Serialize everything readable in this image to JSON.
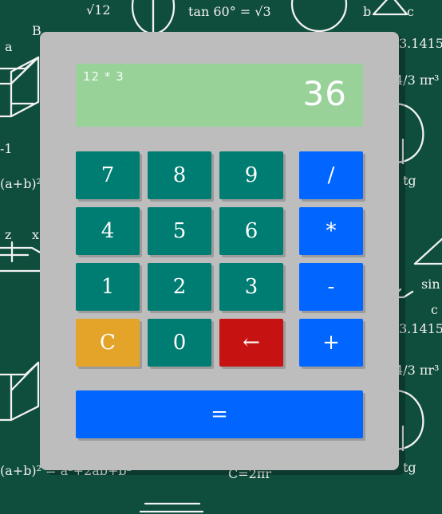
{
  "display": {
    "expression": "12 * 3",
    "result": "36"
  },
  "keys": {
    "seven": "7",
    "eight": "8",
    "nine": "9",
    "divide": "/",
    "four": "4",
    "five": "5",
    "six": "6",
    "multiply": "*",
    "one": "1",
    "two": "2",
    "three": "3",
    "subtract": "-",
    "clear": "C",
    "zero": "0",
    "backspace": "←",
    "add": "+",
    "equals": "="
  },
  "colors": {
    "background": "#0f4d3d",
    "calculator_body": "#bdbdbd",
    "display": "#98d299",
    "number_key": "#007d72",
    "operator_key": "#0066ff",
    "clear_key": "#e4a42a",
    "backspace_key": "#c71212",
    "text": "#ffffff"
  },
  "background_text": {
    "top_sqrt": "√12",
    "top_tan": "tan 60° = √3",
    "top_b": "b",
    "top_c": "c",
    "left_a": "a",
    "left_b": "B",
    "right_pi": "3.1415",
    "right_fraction": "4/3 πr³",
    "right_tg": "tg",
    "left_formula": "(a+b)² = a²",
    "left_minus_one": "-1",
    "left_z": "z",
    "left_x": "x",
    "bottom_formula": "(a+b)² = a²+2ab+b²",
    "bottom_circle": "C=2πr",
    "right_sin": "sin",
    "right_c": "c"
  },
  "icons": {
    "backspace": "arrow-left-icon"
  }
}
